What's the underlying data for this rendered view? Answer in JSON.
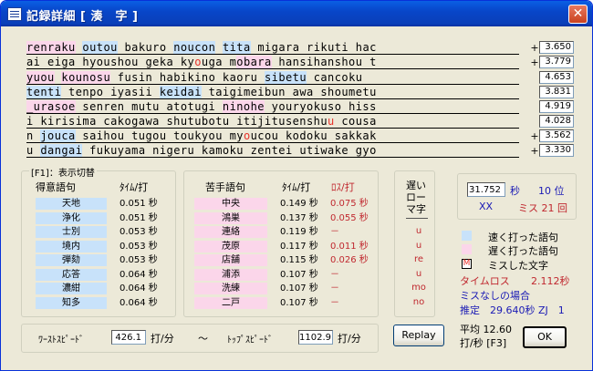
{
  "window": {
    "title": "記録詳細 [ 湊　字 ]",
    "close_glyph": "✕"
  },
  "lines": [
    {
      "mark": "+",
      "time": "3.650",
      "segs": [
        {
          "t": "renraku",
          "c": "pink"
        },
        {
          "t": " "
        },
        {
          "t": "outou",
          "c": "blue"
        },
        {
          "t": " bakuro "
        },
        {
          "t": "noucon",
          "c": "blue"
        },
        {
          "t": " "
        },
        {
          "t": "tita",
          "c": "blue"
        },
        {
          "t": " migara rikuti hac"
        }
      ]
    },
    {
      "mark": "+",
      "time": "3.779",
      "segs": [
        {
          "t": "ai eiga hyoushou geka ky"
        },
        {
          "t": "o",
          "c": "miss"
        },
        {
          "t": "uga m"
        },
        {
          "t": "obara",
          "c": "pink"
        },
        {
          "t": " hansihanshou t"
        }
      ]
    },
    {
      "mark": "",
      "time": "4.653",
      "segs": [
        {
          "t": "yuou",
          "c": "pink"
        },
        {
          "t": " "
        },
        {
          "t": "kounosu",
          "c": "pink"
        },
        {
          "t": " fusin habikino kaoru "
        },
        {
          "t": "sibetu",
          "c": "blue"
        },
        {
          "t": " cancoku"
        }
      ]
    },
    {
      "mark": "",
      "time": "3.831",
      "segs": [
        {
          "t": "tenti",
          "c": "blue"
        },
        {
          "t": " tenpo iyasii "
        },
        {
          "t": "keidai",
          "c": "blue"
        },
        {
          "t": " taigimeibun awa shoumetu"
        }
      ]
    },
    {
      "mark": "",
      "time": "4.919",
      "segs": [
        {
          "t": "_urasoe",
          "c": "pink"
        },
        {
          "t": " senren mutu atotugi "
        },
        {
          "t": "ninohe",
          "c": "pink"
        },
        {
          "t": " youryokuso hiss"
        }
      ]
    },
    {
      "mark": "",
      "time": "4.028",
      "segs": [
        {
          "t": "i kirisima cakogawa shutubotu itijitusenshu"
        },
        {
          "t": "u",
          "c": "miss"
        },
        {
          "t": " cousa"
        }
      ]
    },
    {
      "mark": "+",
      "time": "3.562",
      "segs": [
        {
          "t": "n "
        },
        {
          "t": "jouca",
          "c": "blue"
        },
        {
          "t": " saihou tugou toukyou my"
        },
        {
          "t": "o",
          "c": "miss"
        },
        {
          "t": "ucou kodoku sakkak"
        }
      ]
    },
    {
      "mark": "+",
      "time": "3.330",
      "segs": [
        {
          "t": "u "
        },
        {
          "t": "dangai",
          "c": "blue"
        },
        {
          "t": " fukuyama nigeru kamoku zentei utiwake gyo"
        }
      ]
    }
  ],
  "display_toggle": {
    "legend": "[F1]：表示切替",
    "good_header": "得意語句",
    "time_header": "ﾀｲﾑ/打",
    "good": [
      {
        "word": "天地",
        "time": "0.051 秒"
      },
      {
        "word": "浄化",
        "time": "0.051 秒"
      },
      {
        "word": "士別",
        "time": "0.053 秒"
      },
      {
        "word": "境内",
        "time": "0.053 秒"
      },
      {
        "word": "弾劾",
        "time": "0.053 秒"
      },
      {
        "word": "応答",
        "time": "0.064 秒"
      },
      {
        "word": "濃紺",
        "time": "0.064 秒"
      },
      {
        "word": "知多",
        "time": "0.064 秒"
      }
    ],
    "bad_header": "苦手語句",
    "bad_time_header": "ﾀｲﾑ/打",
    "loss_header": "ﾛｽ/打",
    "bad": [
      {
        "word": "中央",
        "time": "0.149 秒",
        "loss": "0.075 秒"
      },
      {
        "word": "鴻巣",
        "time": "0.137 秒",
        "loss": "0.055 秒"
      },
      {
        "word": "連絡",
        "time": "0.119 秒",
        "loss": "－"
      },
      {
        "word": "茂原",
        "time": "0.117 秒",
        "loss": "0.011 秒"
      },
      {
        "word": "店舗",
        "time": "0.115 秒",
        "loss": "0.026 秒"
      },
      {
        "word": "浦添",
        "time": "0.107 秒",
        "loss": "－"
      },
      {
        "word": "洗練",
        "time": "0.107 秒",
        "loss": "－"
      },
      {
        "word": "二戸",
        "time": "0.107 秒",
        "loss": "－"
      }
    ]
  },
  "slow_romaji": {
    "title_lines": [
      "遅い",
      "ロー",
      "マ字"
    ],
    "letters": [
      "u",
      "u",
      "re",
      "u",
      "mo",
      "no"
    ]
  },
  "result": {
    "total_time": "31.752",
    "sec_unit": "秒",
    "rank": "10 位",
    "xx": "XX",
    "miss": "ミス 21 回"
  },
  "legend": {
    "fast": "速く打った語句",
    "slow": "遅く打った語句",
    "miss_mark": "M",
    "miss": "ミスした文字",
    "fast_color": "#c8e2fa",
    "slow_color": "#fbd6ea"
  },
  "stats": {
    "timeloss_label": "タイムロス",
    "timeloss_value": "2.112秒",
    "nomiss_label": "ミスなしの場合",
    "estimate": "推定　29.640秒 ZJ　1",
    "avg": "平均 12.60",
    "per_sec": "打/秒 [F3]"
  },
  "speed": {
    "worst_label": "ﾜｰｽﾄｽﾋﾟｰﾄﾞ",
    "worst_value": "426.1",
    "unit": "打/分",
    "tilde": "～",
    "top_label": "ﾄｯﾌﾟｽﾋﾟｰﾄﾞ",
    "top_value": "1102.9"
  },
  "buttons": {
    "replay": "Replay",
    "ok": "OK"
  }
}
